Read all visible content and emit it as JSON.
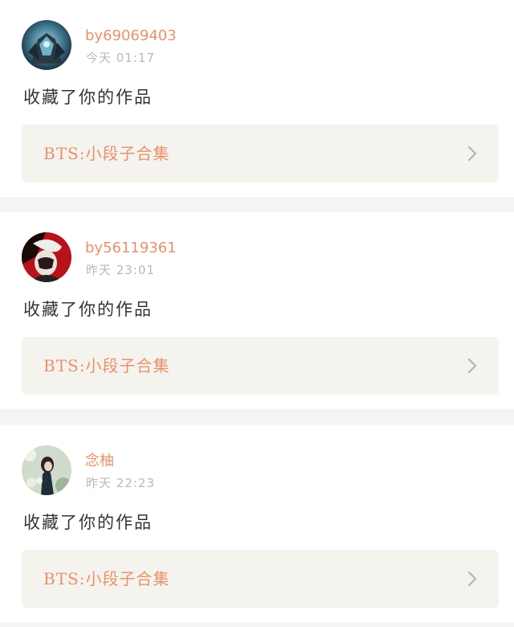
{
  "feed": {
    "items": [
      {
        "username": "by69069403",
        "timestamp": "今天 01:17",
        "action": "收藏了你的作品",
        "work_title": "BTS:小段子合集",
        "avatar": "avatar-armored-knight"
      },
      {
        "username": "by56119361",
        "timestamp": "昨天 23:01",
        "action": "收藏了你的作品",
        "work_title": "BTS:小段子合集",
        "avatar": "avatar-red-white-portrait"
      },
      {
        "username": "念柚",
        "timestamp": "昨天 22:23",
        "action": "收藏了你的作品",
        "work_title": "BTS:小段子合集",
        "avatar": "avatar-girl-with-flowers"
      }
    ]
  },
  "colors": {
    "accent": "#e8926a",
    "muted": "#b9b9b9",
    "card_background": "#ffffff",
    "link_background": "#f4f3ee",
    "page_background": "#f4f4f4"
  },
  "icons": {
    "chevron": "chevron-right-icon"
  }
}
